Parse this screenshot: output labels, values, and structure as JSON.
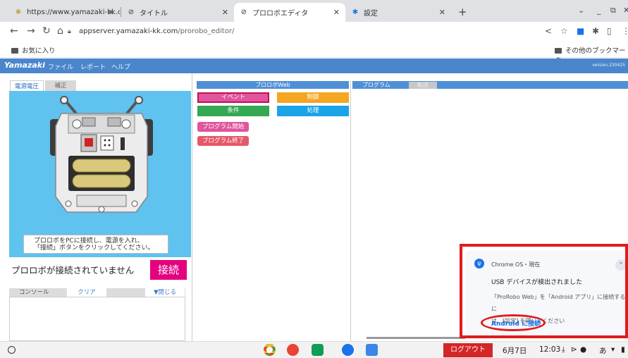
{
  "browser": {
    "tabs": [
      {
        "title": "https://www.yamazaki-kk.com",
        "icon": "yamazaki-favicon"
      },
      {
        "title": "タイトル",
        "icon": "globe-icon"
      },
      {
        "title": "プロロボエディタ",
        "icon": "globe-icon"
      },
      {
        "title": "設定",
        "icon": "gear-icon"
      }
    ],
    "url_host": "appserver.yamazaki-kk.com",
    "url_path": "/prorobo_editor/",
    "bookmark_left": "お気に入り",
    "bookmark_right": "その他のブックマーク"
  },
  "app": {
    "logo": "Yamazaki",
    "menu": [
      "ファイル",
      "レポート",
      "ヘルプ"
    ],
    "version": "version.230425"
  },
  "left": {
    "tabs": [
      "電源電圧",
      "補正"
    ],
    "message_line1": "プロロボをPCに接続し、電源を入れ、",
    "message_line2": "「接続」ボタンをクリックしてください。",
    "status": "プロロボが接続されていません",
    "connect_label": "接続",
    "console_label": "コンソール",
    "clear_label": "クリア",
    "close_label": "▼閉じる"
  },
  "middle": {
    "header": "プロロボWeb",
    "categories": [
      {
        "label": "イベント",
        "color": "#e0559e"
      },
      {
        "label": "制御",
        "color": "#f5a623"
      },
      {
        "label": "条件",
        "color": "#34a853"
      },
      {
        "label": "処理",
        "color": "#1aa3e8"
      }
    ],
    "blocks": [
      "プログラム開始",
      "プログラム終了"
    ]
  },
  "right": {
    "tabs": [
      "プログラム",
      "転送"
    ]
  },
  "notification": {
    "source": "Chrome OS・現在",
    "title": "USB デバイスが検出されました",
    "body_line1": "「ProRobo Web」を「Android アプリ」に接続するに",
    "body_line2": "は、[設定] を開いてください",
    "action": "Android に接続"
  },
  "shelf": {
    "logout_label": "ログアウト",
    "date": "6月7日",
    "time": "12:03",
    "ime": "あ"
  }
}
